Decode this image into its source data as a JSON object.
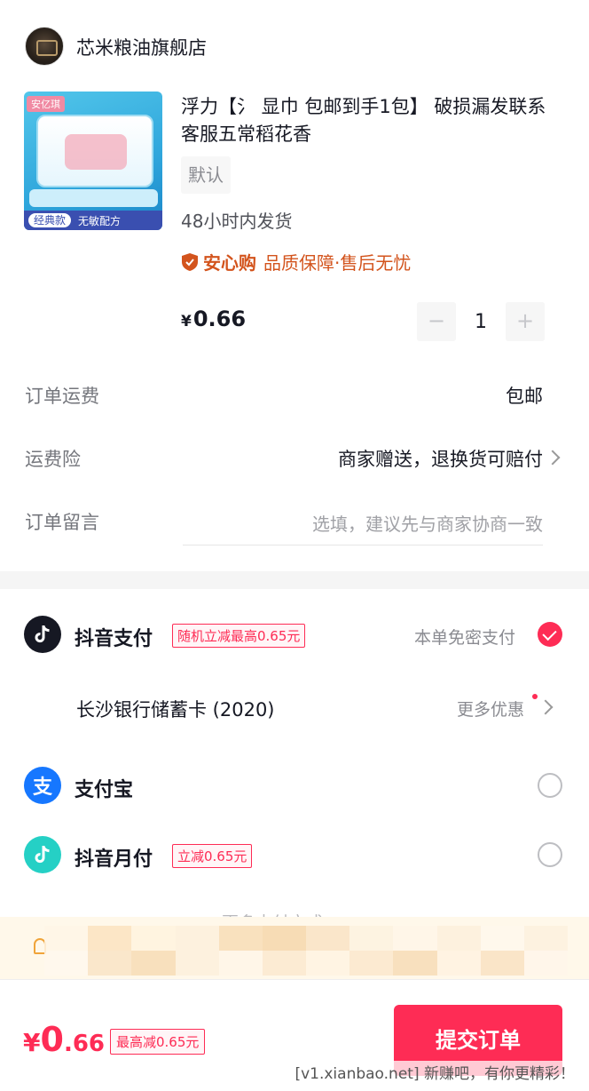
{
  "shop": {
    "name": "芯米粮油旗舰店"
  },
  "product": {
    "thumb_brand": "安亿琪",
    "thumb_badge_a": "经典款",
    "thumb_badge_b": "无敏配方",
    "title": "浮力【氵 显巾   包邮到手1包】 破损漏发联系客服五常稻花香",
    "spec": "默认",
    "ship_time": "48小时内发货",
    "assurance_brand": "安心购",
    "assurance_text": "品质保障·售后无忧",
    "price_symbol": "¥",
    "price": "0.66",
    "quantity": "1",
    "minus": "−",
    "plus": "+"
  },
  "order_rows": {
    "shipping_label": "订单运费",
    "shipping_value": "包邮",
    "insurance_label": "运费险",
    "insurance_value": "商家赠送，退换货可赔付",
    "remark_label": "订单留言",
    "remark_placeholder": "选填，建议先与商家协商一致"
  },
  "payment": {
    "douyin_pay": {
      "name": "抖音支付",
      "promo": "随机立减最高0.65元",
      "note": "本单免密支付",
      "selected": true
    },
    "bank_card": {
      "name": "长沙银行储蓄卡 (2020)",
      "more": "更多优惠"
    },
    "alipay": {
      "name": "支付宝",
      "icon_glyph": "支",
      "selected": false
    },
    "douyin_monthly": {
      "name": "抖音月付",
      "promo": "立减0.65元",
      "selected": false
    },
    "more_ways": "更多支付方式"
  },
  "bottom_bar": {
    "currency": "¥",
    "total_int": "0",
    "total_dec": ".66",
    "max_discount": "最高减0.65元",
    "submit_label": "提交订单"
  },
  "watermark": "[v1.xianbao.net] 新赚吧，有你更精彩！",
  "colors": {
    "accent": "#fe2c55",
    "assurance": "#d3541d",
    "alipay": "#1677ff",
    "douyin_monthly": "#25d0c5"
  }
}
